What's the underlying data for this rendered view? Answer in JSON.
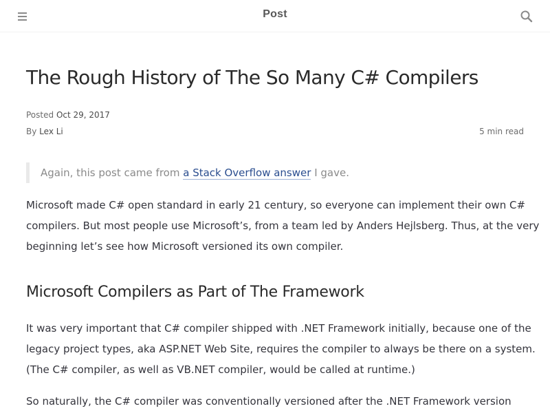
{
  "header": {
    "title": "Post",
    "menu_icon": "hamburger-menu-icon",
    "search_icon": "search-icon"
  },
  "post": {
    "title": "The Rough History of The So Many C# Compilers",
    "posted_label": "Posted",
    "posted_date": "Oct 29, 2017",
    "by_label": "By",
    "author": "Lex Li",
    "read_time": "5 min read",
    "quote": {
      "before": "Again, this post came from",
      "link_text": "a Stack Overflow answer",
      "after": "I gave."
    },
    "paragraph1": [
      "Microsoft made C# open standard in early 21 century, so everyone can implement their own C#",
      "compilers. But most people use Microsoft’s, from a team led by Anders Hejlsberg. Thus, at the very",
      "beginning let’s see how Microsoft versioned its own compiler."
    ],
    "section_heading": "Microsoft Compilers as Part of The Framework",
    "paragraph2": [
      "It was very important that C# compiler shipped with .NET Framework initially, because one of the",
      "legacy project types, aka ASP.NET Web Site, requires the compiler to always be there on a system.",
      "(The C# compiler, as well as VB.NET compiler, would be called at runtime.)"
    ],
    "paragraph3": [
      "So naturally, the C# compiler was conventionally versioned after the .NET Framework version"
    ]
  },
  "colors": {
    "link": "#2a4d8f",
    "text": "#34343c",
    "muted": "#8a8a8a",
    "quote_border": "#e9e9e9"
  }
}
